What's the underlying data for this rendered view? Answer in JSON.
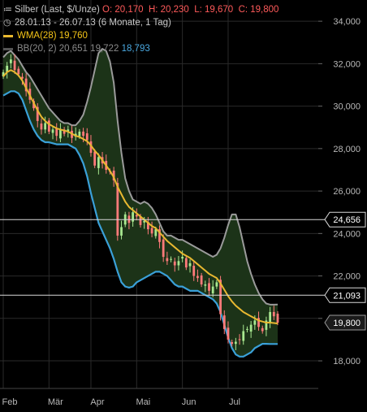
{
  "legend": {
    "instrument": "Silber (Last, $/Unze)",
    "o_label": "O: 20,170",
    "h_label": "H: 20,230",
    "l_label": "L: 19,670",
    "c_label": "C: 19,800",
    "range": "28.01.13 - 26.07.13 (6 Monate, 1 Tag)",
    "wma_label": "WMA(28)",
    "wma_value": "19,760",
    "bb_label": "BB(20, 2)",
    "bb_mid": "20,651",
    "bb_upper": "19,722",
    "bb_lower": "18,793"
  },
  "colors": {
    "background": "#000000",
    "grid": "#2a2a2a",
    "up": "#a8e890",
    "down": "#ff7a7a",
    "wma": "#e8b830",
    "bb_upper": "#9a9a9a",
    "bb_lower": "#3aa0d8",
    "bb_fill": "#1c3318",
    "hline": "#d8d8d8",
    "axis_text": "#b8b8b8"
  },
  "chart_data": {
    "type": "candlestick",
    "x_tick_labels": [
      "Feb",
      "Mär",
      "Apr",
      "Mai",
      "Jun",
      "Jul"
    ],
    "y_ticks": [
      18000,
      20000,
      22000,
      24000,
      26000,
      28000,
      30000,
      32000,
      34000
    ],
    "y_tick_labels": [
      "18,000",
      "20,000",
      "22,000",
      "24,000",
      "26,000",
      "28,000",
      "30,000",
      "32,000",
      "34,000"
    ],
    "ylim": [
      16700,
      35000
    ],
    "grid": true,
    "horizontal_lines": [
      {
        "value": 24656,
        "label": "24,656"
      },
      {
        "value": 21093,
        "label": "21,093"
      }
    ],
    "last_price": {
      "value": 19800,
      "label": "19,800"
    },
    "close": [
      31600,
      31900,
      32200,
      31700,
      31500,
      31300,
      30700,
      30300,
      29900,
      29300,
      28900,
      29200,
      28800,
      28900,
      28600,
      28900,
      28700,
      28900,
      28500,
      28700,
      28800,
      28600,
      28400,
      27800,
      27200,
      27600,
      27300,
      27000,
      26900,
      26500,
      23900,
      24300,
      24900,
      24500,
      25000,
      24800,
      24400,
      24600,
      24200,
      24000,
      24200,
      23600,
      22900,
      22700,
      22800,
      22500,
      22700,
      22900,
      22400,
      22600,
      22000,
      21900,
      21600,
      21600,
      21300,
      21500,
      21700,
      20200,
      19500,
      19000,
      18800,
      18900,
      19000,
      19400,
      19500,
      19700,
      19900,
      19600,
      19400,
      19900,
      20300,
      20100,
      19800
    ],
    "wma": [
      31400,
      31600,
      31700,
      31600,
      31450,
      31200,
      30850,
      30500,
      30150,
      29800,
      29500,
      29300,
      29150,
      29050,
      28950,
      28900,
      28850,
      28800,
      28700,
      28600,
      28550,
      28450,
      28350,
      28150,
      27900,
      27700,
      27450,
      27200,
      26950,
      26650,
      26200,
      25850,
      25500,
      25250,
      25100,
      24950,
      24800,
      24650,
      24500,
      24350,
      24250,
      24050,
      23850,
      23650,
      23500,
      23350,
      23200,
      23050,
      22950,
      22850,
      22700,
      22550,
      22400,
      22250,
      22100,
      22000,
      21900,
      21650,
      21350,
      21050,
      20800,
      20600,
      20450,
      20300,
      20200,
      20100,
      20000,
      19900,
      19850,
      19800,
      19800,
      19780,
      19760
    ],
    "bb_upper": [
      32300,
      32500,
      32600,
      32400,
      32200,
      31900,
      31600,
      31400,
      31100,
      30800,
      30500,
      30200,
      29900,
      29700,
      29500,
      29300,
      29200,
      29200,
      29100,
      29100,
      29300,
      29600,
      30200,
      30900,
      31700,
      32500,
      32700,
      32600,
      32100,
      31100,
      29300,
      27800,
      26600,
      26000,
      25600,
      25500,
      25400,
      25500,
      25400,
      25200,
      24900,
      24500,
      24100,
      23900,
      23900,
      23800,
      23700,
      23700,
      23600,
      23500,
      23400,
      23300,
      23200,
      23100,
      23000,
      22900,
      23000,
      23300,
      23800,
      24400,
      24900,
      24900,
      24300,
      23500,
      22700,
      22100,
      21600,
      21200,
      20900,
      20700,
      20650,
      20650,
      20651
    ],
    "bb_lower": [
      30500,
      30600,
      30700,
      30700,
      30600,
      30300,
      29800,
      29300,
      28900,
      28600,
      28400,
      28300,
      28300,
      28250,
      28200,
      28200,
      28200,
      28200,
      28100,
      28000,
      27700,
      27300,
      26700,
      25900,
      25200,
      24500,
      24100,
      23700,
      23300,
      22800,
      22200,
      21700,
      21500,
      21450,
      21500,
      21700,
      21800,
      21900,
      22000,
      22100,
      22200,
      22200,
      22100,
      22000,
      21800,
      21600,
      21500,
      21500,
      21400,
      21300,
      21300,
      21300,
      21200,
      21100,
      21000,
      20900,
      20700,
      20300,
      19700,
      19100,
      18600,
      18300,
      18200,
      18200,
      18300,
      18400,
      18600,
      18700,
      18800,
      18800,
      18793,
      18793,
      18793
    ]
  }
}
